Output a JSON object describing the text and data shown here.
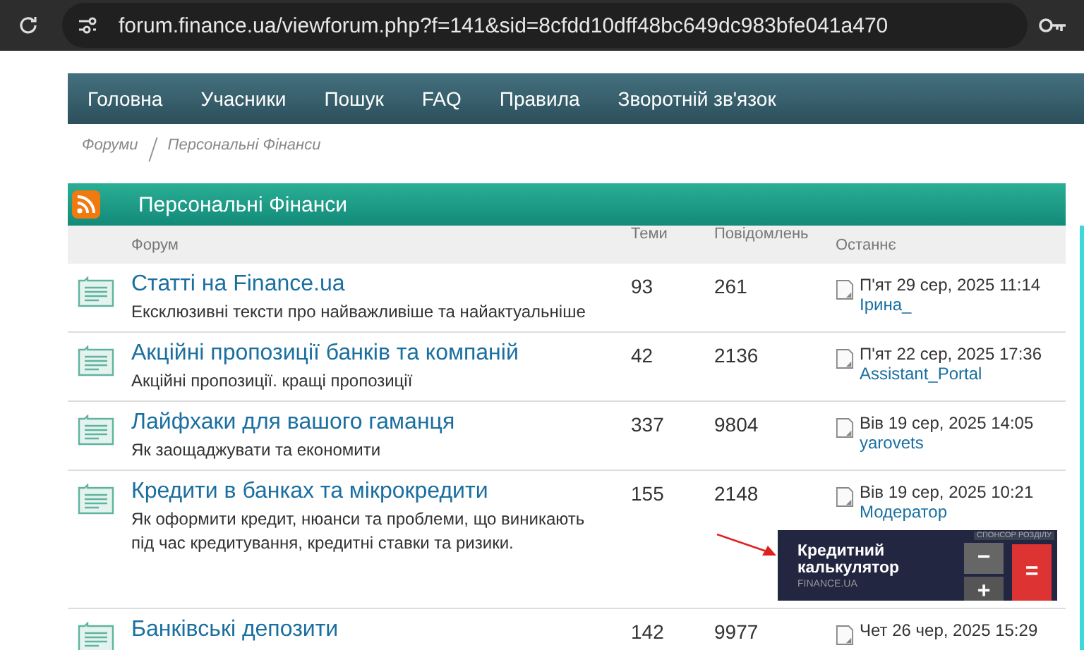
{
  "browser": {
    "url": "forum.finance.ua/viewforum.php?f=141&sid=8cfdd10dff48bc649dc983bfe041a470"
  },
  "nav": [
    {
      "label": "Головна"
    },
    {
      "label": "Учасники"
    },
    {
      "label": "Пошук"
    },
    {
      "label": "FAQ"
    },
    {
      "label": "Правила"
    },
    {
      "label": "Зворотній зв'язок"
    }
  ],
  "breadcrumbs": [
    "Форуми",
    "Персональні Фінанси"
  ],
  "section": {
    "title": "Персональні Фінанси"
  },
  "table": {
    "columns": [
      "Форум",
      "Теми",
      "Повідомлень",
      "Останнє"
    ],
    "rows": [
      {
        "title": "Статті на Finance.ua",
        "description": "Ексклюзивні тексти про найважливіше та найактуальніше",
        "topics": "93",
        "posts": "261",
        "last_date": "П'ят 29 сер, 2025 11:14",
        "last_user": "Ірина_"
      },
      {
        "title": "Акційні пропозиції банків та компаній",
        "description": "Акційні пропозиції. кращі пропозиції",
        "topics": "42",
        "posts": "2136",
        "last_date": "П'ят 22 сер, 2025 17:36",
        "last_user": "Assistant_Portal"
      },
      {
        "title": "Лайфхаки для вашого гаманця",
        "description": "Як заощаджувати та економити",
        "topics": "337",
        "posts": "9804",
        "last_date": "Вів 19 сер, 2025 14:05",
        "last_user": "yarovets"
      },
      {
        "title": "Кредити в банках та мікрокредити",
        "description": "Як оформити кредит, нюанси та проблеми, що виникають під час кредитування, кредитні ставки та ризики.",
        "topics": "155",
        "posts": "2148",
        "last_date": "Вів 19 сер, 2025 10:21",
        "last_user": "Модератор",
        "banner": {
          "sponsor": "СПОНСОР РОЗДІЛУ",
          "title": "Кредитний калькулятор",
          "brand": "FINANCE.UA",
          "keys": [
            "−",
            "+",
            "="
          ]
        }
      },
      {
        "title": "Банківські депозити",
        "topics": "142",
        "posts": "9977",
        "last_date": "Чет 26 чер, 2025 15:29"
      }
    ]
  }
}
